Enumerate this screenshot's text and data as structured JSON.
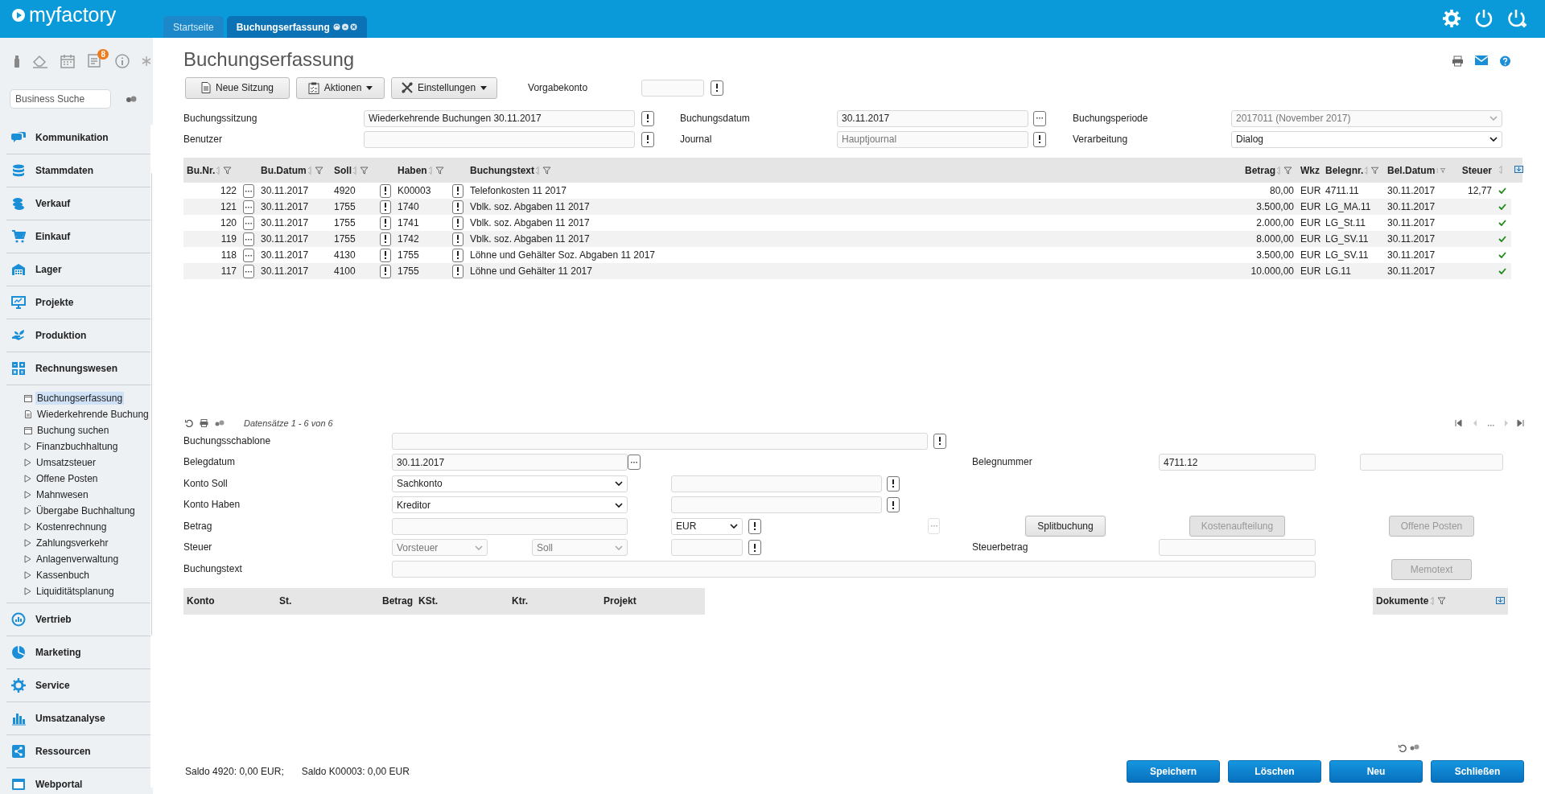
{
  "app": {
    "logo": "myfactory"
  },
  "tabs": [
    {
      "label": "Startseite",
      "selected": false
    },
    {
      "label": "Buchungserfassung",
      "selected": true
    }
  ],
  "sidebar": {
    "badge": "8",
    "search": {
      "placeholder": "Business Suche"
    },
    "items": [
      {
        "label": "Kommunikation",
        "expanded": false
      },
      {
        "label": "Stammdaten",
        "expanded": false
      },
      {
        "label": "Verkauf",
        "expanded": false
      },
      {
        "label": "Einkauf",
        "expanded": false
      },
      {
        "label": "Lager",
        "expanded": false
      },
      {
        "label": "Projekte",
        "expanded": false
      },
      {
        "label": "Produktion",
        "expanded": false
      },
      {
        "label": "Rechnungswesen",
        "expanded": true,
        "children": [
          {
            "label": "Buchungserfassung",
            "kind": "page",
            "selected": true
          },
          {
            "label": "Wiederkehrende Buchung",
            "kind": "document",
            "selected": false
          },
          {
            "label": "Buchung suchen",
            "kind": "page",
            "selected": false
          },
          {
            "label": "Finanzbuchhaltung",
            "kind": "folder",
            "selected": false
          },
          {
            "label": "Umsatzsteuer",
            "kind": "folder",
            "selected": false
          },
          {
            "label": "Offene Posten",
            "kind": "folder",
            "selected": false
          },
          {
            "label": "Mahnwesen",
            "kind": "folder",
            "selected": false
          },
          {
            "label": "Übergabe Buchhaltung",
            "kind": "folder",
            "selected": false
          },
          {
            "label": "Kostenrechnung",
            "kind": "folder",
            "selected": false
          },
          {
            "label": "Zahlungsverkehr",
            "kind": "folder",
            "selected": false
          },
          {
            "label": "Anlagenverwaltung",
            "kind": "folder",
            "selected": false
          },
          {
            "label": "Kassenbuch",
            "kind": "folder",
            "selected": false
          },
          {
            "label": "Liquiditätsplanung",
            "kind": "folder",
            "selected": false
          }
        ]
      },
      {
        "label": "Vertrieb",
        "expanded": false
      },
      {
        "label": "Marketing",
        "expanded": false
      },
      {
        "label": "Service",
        "expanded": false
      },
      {
        "label": "Umsatzanalyse",
        "expanded": false
      },
      {
        "label": "Ressourcen",
        "expanded": false
      },
      {
        "label": "Webportal",
        "expanded": false
      }
    ]
  },
  "page": {
    "title": "Buchungserfassung"
  },
  "toolbar": {
    "buttons": [
      {
        "label": "Neue Sitzung",
        "kind": "command"
      },
      {
        "label": "Aktionen",
        "kind": "menu"
      },
      {
        "label": "Einstellungen",
        "kind": "menu"
      }
    ],
    "default_account": {
      "label": "Vorgabekonto"
    }
  },
  "session": {
    "booking_session": {
      "label": "Buchungssitzung",
      "value": "Wiederkehrende Buchungen 30.11.2017"
    },
    "booking_date": {
      "label": "Buchungsdatum",
      "value": "30.11.2017"
    },
    "period": {
      "label": "Buchungsperiode",
      "value": "2017011 (November 2017)",
      "disabled": true
    },
    "user": {
      "label": "Benutzer"
    },
    "journal": {
      "label": "Journal",
      "value": "Hauptjournal",
      "disabled": true
    },
    "processing": {
      "label": "Verarbeitung",
      "value": "Dialog",
      "disabled": false
    }
  },
  "bookings": {
    "columns": [
      "Bu.Nr.",
      "Bu.Datum",
      "Soll",
      "Haben",
      "Buchungstext",
      "Betrag",
      "Wkz",
      "Belegnr.",
      "Bel.Datum",
      "Steuer"
    ],
    "rows": [
      {
        "nr": "122",
        "date": "30.11.2017",
        "debit": "4920",
        "credit": "K00003",
        "text": "Telefonkosten 11 2017",
        "amount": "80,00",
        "currency": "EUR",
        "voucher": "4711.11",
        "voucher_date": "30.11.2017",
        "tax": "12,77",
        "checked": true
      },
      {
        "nr": "121",
        "date": "30.11.2017",
        "debit": "1755",
        "credit": "1740",
        "text": "Vblk. soz. Abgaben 11 2017",
        "amount": "3.500,00",
        "currency": "EUR",
        "voucher": "LG_MA.11",
        "voucher_date": "30.11.2017",
        "checked": true
      },
      {
        "nr": "120",
        "date": "30.11.2017",
        "debit": "1755",
        "credit": "1741",
        "text": "Vblk. soz. Abgaben 11 2017",
        "amount": "2.000,00",
        "currency": "EUR",
        "voucher": "LG_St.11",
        "voucher_date": "30.11.2017",
        "checked": true
      },
      {
        "nr": "119",
        "date": "30.11.2017",
        "debit": "1755",
        "credit": "1742",
        "text": "Vblk. soz. Abgaben 11 2017",
        "amount": "8.000,00",
        "currency": "EUR",
        "voucher": "LG_SV.11",
        "voucher_date": "30.11.2017",
        "checked": true
      },
      {
        "nr": "118",
        "date": "30.11.2017",
        "debit": "4130",
        "credit": "1755",
        "text": "Löhne und Gehälter Soz. Abgaben 11 2017",
        "amount": "3.500,00",
        "currency": "EUR",
        "voucher": "LG_SV.11",
        "voucher_date": "30.11.2017",
        "checked": true
      },
      {
        "nr": "117",
        "date": "30.11.2017",
        "debit": "4100",
        "credit": "1755",
        "text": "Löhne und Gehälter 11 2017",
        "amount": "10.000,00",
        "currency": "EUR",
        "voucher": "LG.11",
        "voucher_date": "30.11.2017",
        "checked": true
      }
    ],
    "record_count": "Datensätze 1 - 6 von 6"
  },
  "entry": {
    "template": {
      "label": "Buchungsschablone"
    },
    "voucher_date": {
      "label": "Belegdatum",
      "value": "30.11.2017"
    },
    "voucher_number": {
      "label": "Belegnummer",
      "value": "4711.12"
    },
    "debit": {
      "label": "Konto Soll",
      "value": "Sachkonto"
    },
    "credit": {
      "label": "Konto Haben",
      "value": "Kreditor"
    },
    "amount": {
      "label": "Betrag",
      "currency": "EUR",
      "lookup_disabled": true
    },
    "tax": {
      "label": "Steuer",
      "type": "Vorsteuer",
      "side": "Soll",
      "disabled": true
    },
    "tax_amount": {
      "label": "Steuerbetrag"
    },
    "text": {
      "label": "Buchungstext"
    },
    "buttons": [
      {
        "label": "Splitbuchung",
        "disabled": false
      },
      {
        "label": "Kostenaufteilung",
        "disabled": true
      },
      {
        "label": "Offene Posten",
        "disabled": true
      },
      {
        "label": "Memotext",
        "disabled": true
      }
    ]
  },
  "splits": {
    "columns": [
      "Konto",
      "St.",
      "Betrag",
      "KSt.",
      "Ktr.",
      "Projekt"
    ]
  },
  "documents": {
    "columns": [
      "Dokumente"
    ]
  },
  "status": [
    "Saldo 4920: 0,00 EUR;",
    "Saldo K00003: 0,00 EUR"
  ],
  "actions": [
    {
      "label": "Speichern"
    },
    {
      "label": "Löschen"
    },
    {
      "label": "Neu"
    },
    {
      "label": "Schließen"
    }
  ]
}
